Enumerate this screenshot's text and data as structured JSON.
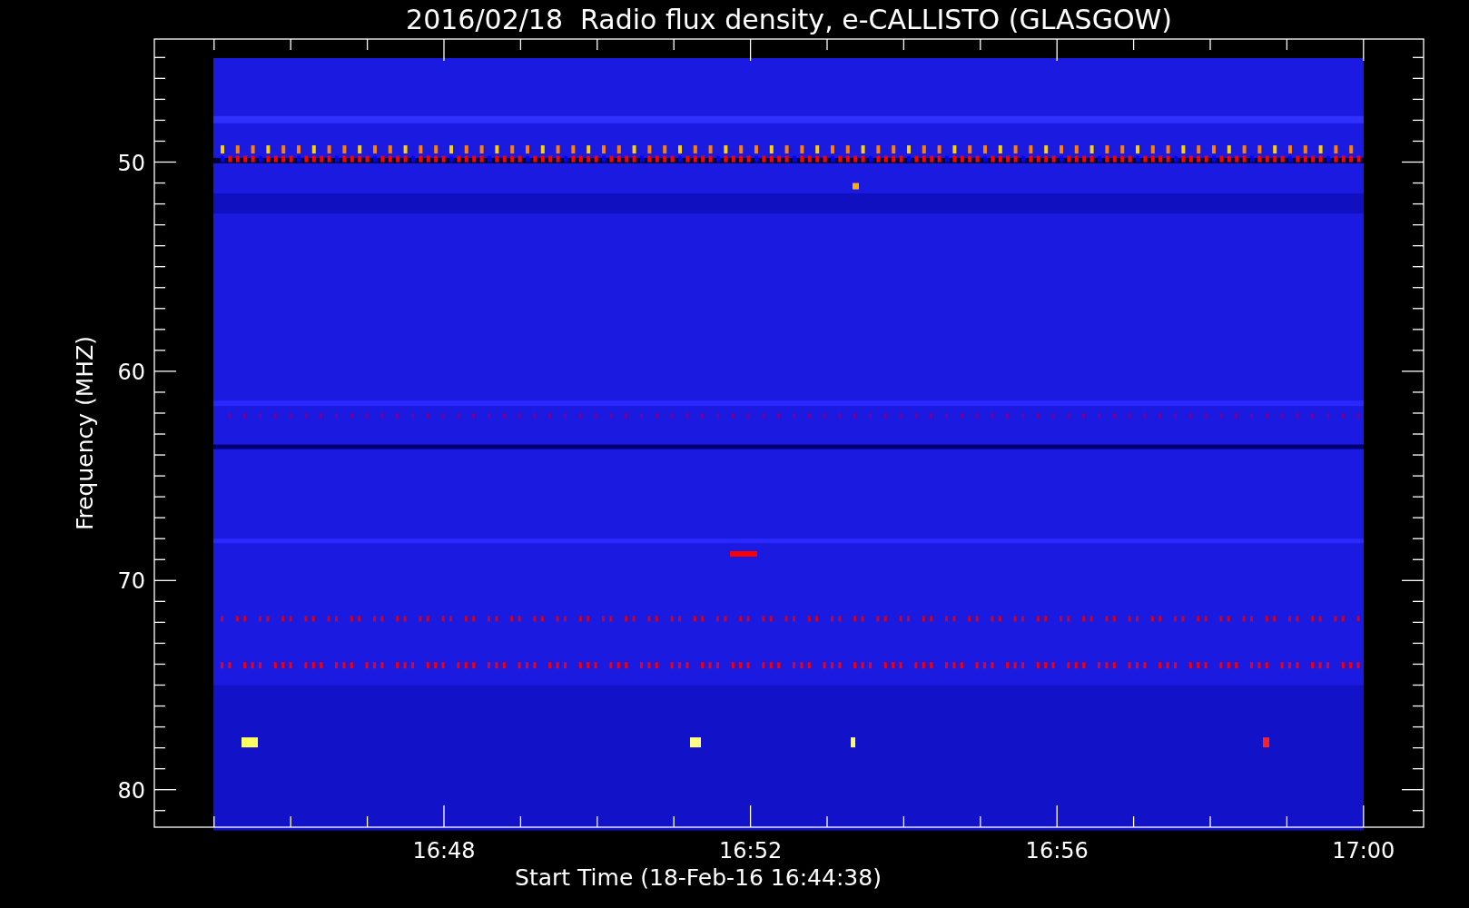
{
  "title": "2016/02/18  Radio flux density, e-CALLISTO (GLASGOW)",
  "y_axis": {
    "label": "Frequency (MHZ)",
    "ticks": [
      "50",
      "60",
      "70",
      "80"
    ]
  },
  "x_axis": {
    "label": "Start Time (18-Feb-16 16:44:38)",
    "ticks": [
      "16:48",
      "16:52",
      "16:56",
      "17:00"
    ]
  }
}
